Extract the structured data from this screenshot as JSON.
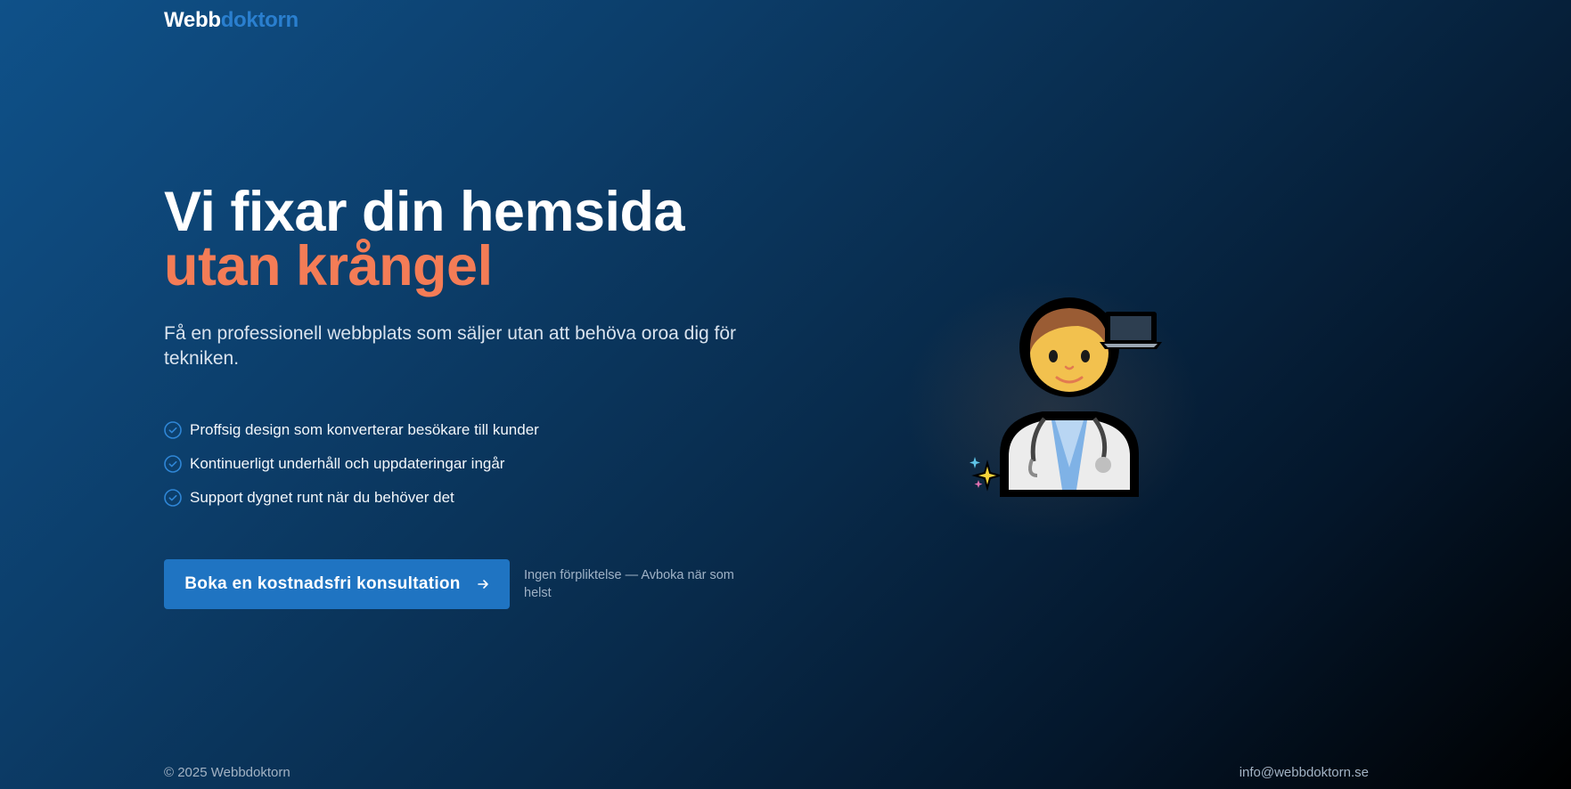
{
  "logo": {
    "part1": "Webb",
    "part2": "doktorn"
  },
  "hero": {
    "headline_line1": "Vi fixar din hemsida",
    "headline_line2": "utan krångel",
    "lead": "Få en professionell webbplats som säljer utan att behöva oroa dig för tekniken.",
    "features": [
      "Proffsig design som konverterar besökare till kunder",
      "Kontinuerligt underhåll och uppdateringar ingår",
      "Support dygnet runt när du behöver det"
    ],
    "cta_label": "Boka en kostnadsfri konsultation",
    "cta_note": "Ingen förpliktelse — Avboka när som helst"
  },
  "footer": {
    "copyright": "© 2025 Webbdoktorn",
    "email": "info@webbdoktorn.se"
  },
  "colors": {
    "accent_orange": "#f47c56",
    "primary_blue": "#1f74c2",
    "logo_blue": "#2a7fcf"
  },
  "icons": {
    "check": "check-circle-icon",
    "arrow": "arrow-right-icon",
    "illustration": "doctor-with-laptop-icon"
  }
}
